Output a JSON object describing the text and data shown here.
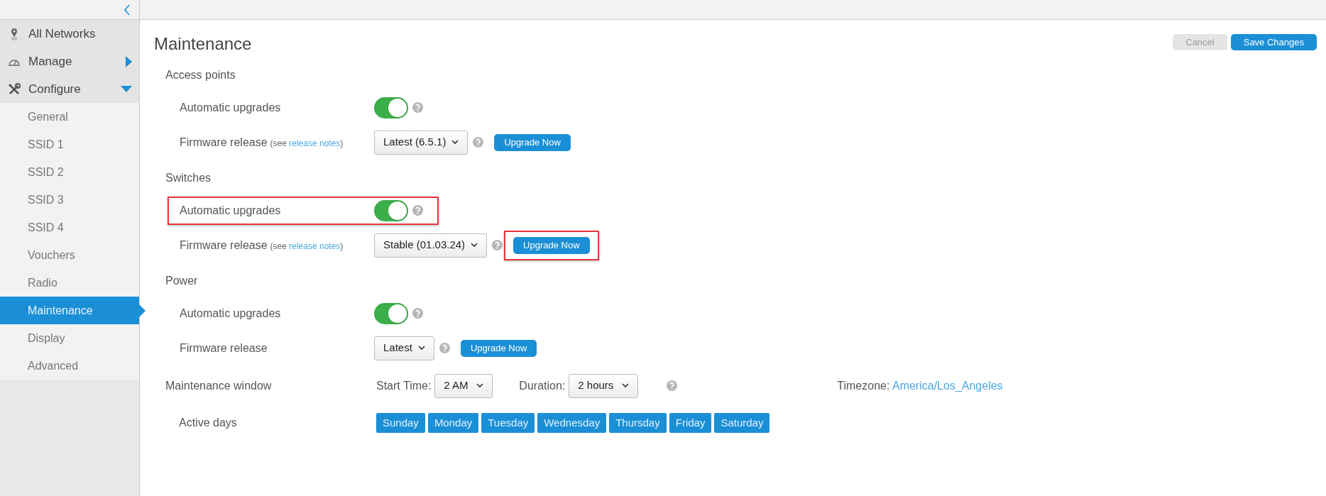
{
  "sidebar": {
    "items": [
      {
        "label": "All Networks",
        "kind": "top",
        "selected": false
      },
      {
        "label": "Manage",
        "kind": "top",
        "expanded": false,
        "selected": false
      },
      {
        "label": "Configure",
        "kind": "top",
        "expanded": true,
        "selected": false
      },
      {
        "label": "General",
        "kind": "sub",
        "selected": false
      },
      {
        "label": "SSID 1",
        "kind": "sub",
        "selected": false
      },
      {
        "label": "SSID 2",
        "kind": "sub",
        "selected": false
      },
      {
        "label": "SSID 3",
        "kind": "sub",
        "selected": false
      },
      {
        "label": "SSID 4",
        "kind": "sub",
        "selected": false
      },
      {
        "label": "Vouchers",
        "kind": "sub",
        "selected": false
      },
      {
        "label": "Radio",
        "kind": "sub",
        "selected": false
      },
      {
        "label": "Maintenance",
        "kind": "sub",
        "selected": true
      },
      {
        "label": "Display",
        "kind": "sub",
        "selected": false
      },
      {
        "label": "Advanced",
        "kind": "sub",
        "selected": false
      }
    ]
  },
  "page": {
    "title": "Maintenance",
    "actions": [
      {
        "label": "Cancel",
        "disabled": true
      },
      {
        "label": "Save Changes",
        "disabled": false
      }
    ],
    "sections": [
      {
        "title": "Access points",
        "rows": [
          {
            "kind": "toggle",
            "label": "Automatic upgrades",
            "on": true,
            "highlighted": false
          },
          {
            "kind": "firmware",
            "label": "Firmware release",
            "note_before": "(see ",
            "note_link": "release notes",
            "note_after": ")",
            "value": "Latest (6.5.1)",
            "button": "Upgrade Now",
            "highlighted": false
          }
        ]
      },
      {
        "title": "Switches",
        "rows": [
          {
            "kind": "toggle",
            "label": "Automatic upgrades",
            "on": true,
            "highlighted": true
          },
          {
            "kind": "firmware",
            "label": "Firmware release",
            "note_before": "(see ",
            "note_link": "release notes",
            "note_after": ")",
            "value": "Stable (01.03.24)",
            "button": "Upgrade Now",
            "highlighted": true
          }
        ]
      },
      {
        "title": "Power",
        "rows": [
          {
            "kind": "toggle",
            "label": "Automatic upgrades",
            "on": true,
            "highlighted": false
          },
          {
            "kind": "firmware",
            "label": "Firmware release",
            "value": "Latest",
            "button": "Upgrade Now",
            "highlighted": false
          }
        ]
      }
    ],
    "maintenance_window": {
      "label": "Maintenance window",
      "start_label": "Start Time:",
      "start_value": "2 AM",
      "duration_label": "Duration:",
      "duration_value": "2 hours",
      "timezone_label": "Timezone:",
      "timezone_value": "America/Los_Angeles"
    },
    "active_days": {
      "label": "Active days",
      "days": [
        {
          "label": "Sunday",
          "selected": true
        },
        {
          "label": "Monday",
          "selected": true
        },
        {
          "label": "Tuesday",
          "selected": true
        },
        {
          "label": "Wednesday",
          "selected": true
        },
        {
          "label": "Thursday",
          "selected": true
        },
        {
          "label": "Friday",
          "selected": true
        },
        {
          "label": "Saturday",
          "selected": true
        }
      ]
    }
  }
}
